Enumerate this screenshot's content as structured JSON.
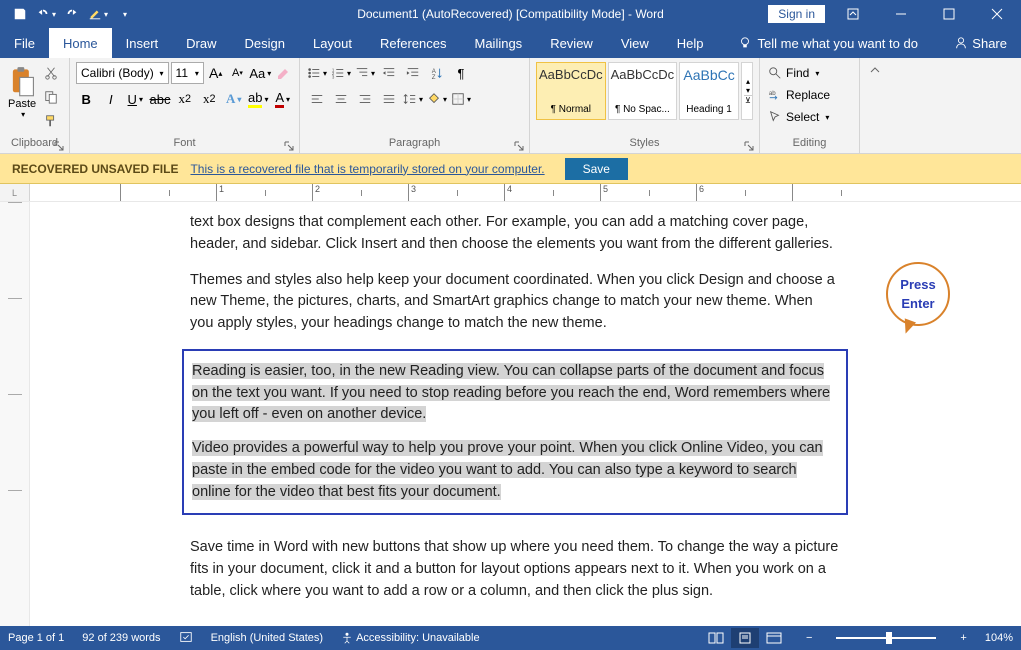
{
  "titlebar": {
    "title": "Document1 (AutoRecovered) [Compatibility Mode]  -  Word",
    "sign_in": "Sign in"
  },
  "tabs": {
    "file": "File",
    "home": "Home",
    "insert": "Insert",
    "draw": "Draw",
    "design": "Design",
    "layout": "Layout",
    "references": "References",
    "mailings": "Mailings",
    "review": "Review",
    "view": "View",
    "help": "Help",
    "tell_me": "Tell me what you want to do",
    "share": "Share"
  },
  "ribbon": {
    "clipboard": {
      "label": "Clipboard",
      "paste": "Paste"
    },
    "font": {
      "label": "Font",
      "name": "Calibri (Body)",
      "size": "11"
    },
    "paragraph": {
      "label": "Paragraph"
    },
    "styles": {
      "label": "Styles",
      "normal_sample": "AaBbCcDc",
      "normal": "¶ Normal",
      "nospace_sample": "AaBbCcDc",
      "nospace": "¶ No Spac...",
      "h1_sample": "AaBbCc",
      "h1": "Heading 1"
    },
    "editing": {
      "label": "Editing",
      "find": "Find",
      "replace": "Replace",
      "select": "Select"
    }
  },
  "msgbar": {
    "label": "RECOVERED UNSAVED FILE",
    "text": "This is a recovered file that is temporarily stored on your computer.",
    "save": "Save"
  },
  "ruler": {
    "corner": "L",
    "ticks": [
      "",
      "1",
      "2",
      "3",
      "4",
      "5",
      "6",
      ""
    ]
  },
  "doc": {
    "p1": "text box designs that complement each other. For example, you can add a matching cover page, header, and sidebar. Click Insert and then choose the elements you want from the different galleries.",
    "p2": "Themes and styles also help keep your document coordinated. When you click Design and choose a new Theme, the pictures, charts, and SmartArt graphics change to match your new theme. When you apply styles, your headings change to match the new theme.",
    "p3": "Reading is easier, too, in the new Reading view. You can collapse parts of the document and focus on the text you want. If you need to stop reading before you reach the end, Word remembers where you left off - even on another device.",
    "p4": "Video provides a powerful way to help you prove your point. When you click Online Video, you can paste in the embed code for the video you want to add. You can also type a keyword to search online for the video that best fits your document.",
    "p5": "Save time in Word with new buttons that show up where you need them. To change the way a picture fits in your document, click it and a button for layout options appears next to it. When you work on a table, click where you want to add a row or a column, and then click the plus sign.",
    "callout_l1": "Press",
    "callout_l2": "Enter"
  },
  "status": {
    "page": "Page 1 of 1",
    "words": "92 of 239 words",
    "lang": "English (United States)",
    "accessibility": "Accessibility: Unavailable",
    "zoom_minus": "−",
    "zoom_plus": "+",
    "zoom": "104%"
  }
}
